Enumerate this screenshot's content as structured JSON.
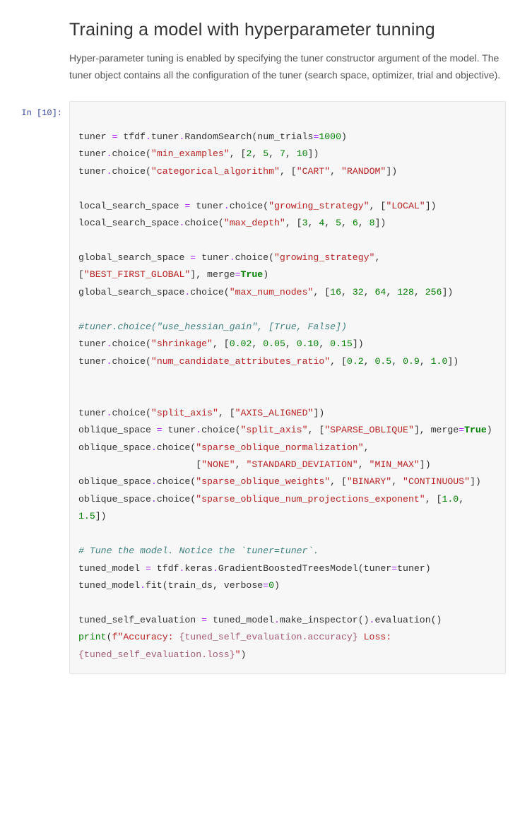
{
  "heading": "Training a model with hyperparameter tunning",
  "description": "Hyper-parameter tuning is enabled by specifying the tuner constructor argument of the model. The tuner object contains all the configuration of the tuner (search space, optimizer, trial and objective).",
  "prompt_label": "In [10]:",
  "code": {
    "l1a": "tuner ",
    "l1b": "=",
    "l1c": " tfdf",
    "l1d": ".",
    "l1e": "tuner",
    "l1f": ".",
    "l1g": "RandomSearch(num_trials",
    "l1h": "=",
    "l1i": "1000",
    "l1j": ")",
    "l2a": "tuner",
    "l2b": ".",
    "l2c": "choice(",
    "l2d": "\"min_examples\"",
    "l2e": ", [",
    "l2f": "2",
    "l2g": ", ",
    "l2h": "5",
    "l2i": ", ",
    "l2j": "7",
    "l2k": ", ",
    "l2l": "10",
    "l2m": "])",
    "l3a": "tuner",
    "l3b": ".",
    "l3c": "choice(",
    "l3d": "\"categorical_algorithm\"",
    "l3e": ", [",
    "l3f": "\"CART\"",
    "l3g": ", ",
    "l3h": "\"RANDOM\"",
    "l3i": "])",
    "l4a": "local_search_space ",
    "l4b": "=",
    "l4c": " tuner",
    "l4d": ".",
    "l4e": "choice(",
    "l4f": "\"growing_strategy\"",
    "l4g": ", [",
    "l4h": "\"LOCAL\"",
    "l4i": "])",
    "l5a": "local_search_space",
    "l5b": ".",
    "l5c": "choice(",
    "l5d": "\"max_depth\"",
    "l5e": ", [",
    "l5f": "3",
    "l5g": ", ",
    "l5h": "4",
    "l5i": ", ",
    "l5j": "5",
    "l5k": ", ",
    "l5l": "6",
    "l5m": ", ",
    "l5n": "8",
    "l5o": "])",
    "l6a": "global_search_space ",
    "l6b": "=",
    "l6c": " tuner",
    "l6d": ".",
    "l6e": "choice(",
    "l6f": "\"growing_strategy\"",
    "l6g": ", [",
    "l6h": "\"BEST_FIRST_GLOBAL\"",
    "l6i": "], merge",
    "l6j": "=",
    "l6k": "True",
    "l6l": ")",
    "l7a": "global_search_space",
    "l7b": ".",
    "l7c": "choice(",
    "l7d": "\"max_num_nodes\"",
    "l7e": ", [",
    "l7f": "16",
    "l7g": ", ",
    "l7h": "32",
    "l7i": ", ",
    "l7j": "64",
    "l7k": ", ",
    "l7l": "128",
    "l7m": ", ",
    "l7n": "256",
    "l7o": "])",
    "l8": "#tuner.choice(\"use_hessian_gain\", [True, False])",
    "l9a": "tuner",
    "l9b": ".",
    "l9c": "choice(",
    "l9d": "\"shrinkage\"",
    "l9e": ", [",
    "l9f": "0.02",
    "l9g": ", ",
    "l9h": "0.05",
    "l9i": ", ",
    "l9j": "0.10",
    "l9k": ", ",
    "l9l": "0.15",
    "l9m": "])",
    "l10a": "tuner",
    "l10b": ".",
    "l10c": "choice(",
    "l10d": "\"num_candidate_attributes_ratio\"",
    "l10e": ", [",
    "l10f": "0.2",
    "l10g": ", ",
    "l10h": "0.5",
    "l10i": ", ",
    "l10j": "0.9",
    "l10k": ", ",
    "l10l": "1.0",
    "l10m": "])",
    "l11a": "tuner",
    "l11b": ".",
    "l11c": "choice(",
    "l11d": "\"split_axis\"",
    "l11e": ", [",
    "l11f": "\"AXIS_ALIGNED\"",
    "l11g": "])",
    "l12a": "oblique_space ",
    "l12b": "=",
    "l12c": " tuner",
    "l12d": ".",
    "l12e": "choice(",
    "l12f": "\"split_axis\"",
    "l12g": ", [",
    "l12h": "\"SPARSE_OBLIQUE\"",
    "l12i": "], merge",
    "l12j": "=",
    "l12k": "True",
    "l12l": ")",
    "l13a": "oblique_space",
    "l13b": ".",
    "l13c": "choice(",
    "l13d": "\"sparse_oblique_normalization\"",
    "l13e": ",",
    "l14a": "                     [",
    "l14b": "\"NONE\"",
    "l14c": ", ",
    "l14d": "\"STANDARD_DEVIATION\"",
    "l14e": ", ",
    "l14f": "\"MIN_MAX\"",
    "l14g": "])",
    "l15a": "oblique_space",
    "l15b": ".",
    "l15c": "choice(",
    "l15d": "\"sparse_oblique_weights\"",
    "l15e": ", [",
    "l15f": "\"BINARY\"",
    "l15g": ", ",
    "l15h": "\"CONTINUOUS\"",
    "l15i": "])",
    "l16a": "oblique_space",
    "l16b": ".",
    "l16c": "choice(",
    "l16d": "\"sparse_oblique_num_projections_exponent\"",
    "l16e": ", [",
    "l16f": "1.0",
    "l16g": ", ",
    "l16h": "1.5",
    "l16i": "])",
    "l17": "# Tune the model. Notice the `tuner=tuner`.",
    "l18a": "tuned_model ",
    "l18b": "=",
    "l18c": " tfdf",
    "l18d": ".",
    "l18e": "keras",
    "l18f": ".",
    "l18g": "GradientBoostedTreesModel(tuner",
    "l18h": "=",
    "l18i": "tuner)",
    "l19a": "tuned_model",
    "l19b": ".",
    "l19c": "fit(train_ds, verbose",
    "l19d": "=",
    "l19e": "0",
    "l19f": ")",
    "l20a": "tuned_self_evaluation ",
    "l20b": "=",
    "l20c": " tuned_model",
    "l20d": ".",
    "l20e": "make_inspector()",
    "l20f": ".",
    "l20g": "evaluation()",
    "l21a": "print",
    "l21b": "(",
    "l21c": "f\"Accuracy: ",
    "l21d": "{tuned_self_evaluation.accuracy}",
    "l21e": " Loss:",
    "l21f": "{tuned_self_evaluation.loss}",
    "l21g": "\"",
    "l21h": ")"
  }
}
